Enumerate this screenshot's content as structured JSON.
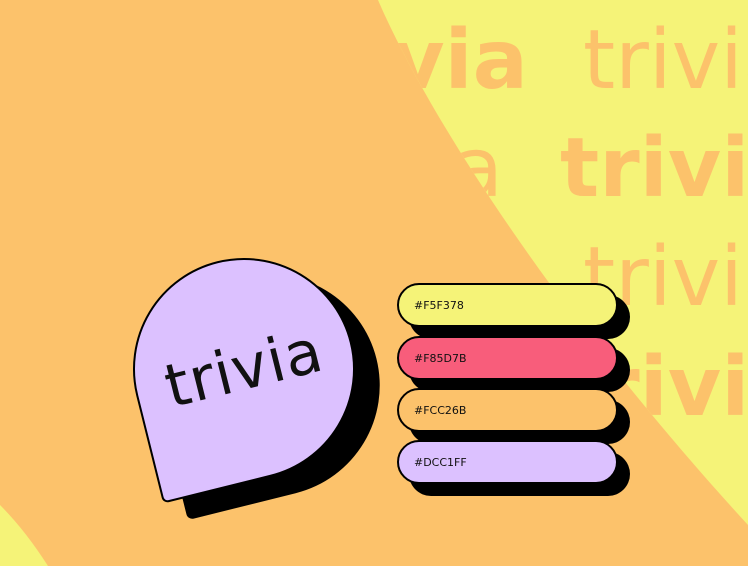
{
  "colors": {
    "background": "#FCC26B",
    "yellow": "#F5F378",
    "pink": "#F85D7B",
    "orange": "#FCC26B",
    "lavender": "#DCC1FF",
    "ink": "#000000"
  },
  "watermark_word": "trivia",
  "badge": {
    "label": "trivia"
  },
  "swatches": [
    {
      "label": "#F5F378",
      "color": "#F5F378"
    },
    {
      "label": "#F85D7B",
      "color": "#F85D7B"
    },
    {
      "label": "#FCC26B",
      "color": "#FCC26B"
    },
    {
      "label": "#DCC1FF",
      "color": "#DCC1FF"
    }
  ]
}
